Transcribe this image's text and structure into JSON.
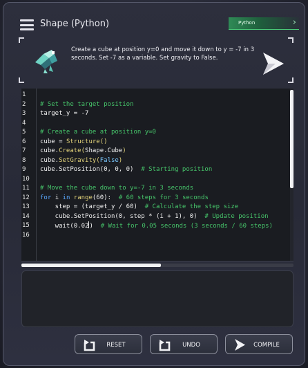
{
  "header": {
    "title": "Shape (Python)",
    "language_tab": "Python"
  },
  "task": {
    "text": "Create a cube at position y=0 and move it down to y = -7 in 3 seconds. Set -7 as a variable. Set gravity to False."
  },
  "editor": {
    "line_numbers": [
      "1",
      "2",
      "3",
      "4",
      "5",
      "6",
      "7",
      "8",
      "9",
      "10",
      "11",
      "12",
      "13",
      "14",
      "15",
      "16"
    ],
    "lines": [
      [],
      [
        {
          "t": "# Set the target position",
          "c": "comment"
        }
      ],
      [
        {
          "t": "target_y = -7",
          "c": "ident"
        }
      ],
      [],
      [
        {
          "t": "# Create a cube at position y=0",
          "c": "comment"
        }
      ],
      [
        {
          "t": "cube = ",
          "c": "ident"
        },
        {
          "t": "Structure()",
          "c": "call"
        }
      ],
      [
        {
          "t": "cube.",
          "c": "ident"
        },
        {
          "t": "Create(",
          "c": "call"
        },
        {
          "t": "Shape.Cube",
          "c": "ident"
        },
        {
          "t": ")",
          "c": "call"
        }
      ],
      [
        {
          "t": "cube.",
          "c": "ident"
        },
        {
          "t": "SetGravity(",
          "c": "call"
        },
        {
          "t": "False",
          "c": "const"
        },
        {
          "t": ")",
          "c": "call"
        }
      ],
      [
        {
          "t": "cube.SetPosition(0, 0, 0)  ",
          "c": "ident"
        },
        {
          "t": "# Starting position",
          "c": "comment"
        }
      ],
      [],
      [
        {
          "t": "# Move the cube down to y=-7 in 3 seconds",
          "c": "comment"
        }
      ],
      [
        {
          "t": "for ",
          "c": "keyword"
        },
        {
          "t": "i ",
          "c": "ident"
        },
        {
          "t": "in ",
          "c": "keyword"
        },
        {
          "t": "range",
          "c": "call"
        },
        {
          "t": "(60):  ",
          "c": "ident"
        },
        {
          "t": "# 60 steps for 3 seconds",
          "c": "comment"
        }
      ],
      [
        {
          "t": "    step = (target_y / 60)  ",
          "c": "ident"
        },
        {
          "t": "# Calculate the step size",
          "c": "comment"
        }
      ],
      [
        {
          "t": "    cube.SetPosition(0, step * (i + 1), 0)  ",
          "c": "ident"
        },
        {
          "t": "# Update position",
          "c": "comment"
        }
      ],
      [
        {
          "t": "    wait(0.02",
          "c": "ident"
        },
        {
          "t": "|caret|",
          "c": "caret"
        },
        {
          "t": ")  ",
          "c": "ident"
        },
        {
          "t": "# Wait for 0.05 seconds (3 seconds / 60 steps)",
          "c": "comment"
        }
      ],
      []
    ]
  },
  "buttons": {
    "reset": "RESET",
    "undo": "UNDO",
    "compile": "COMPILE"
  },
  "colors": {
    "comment": "#46c46a",
    "keyword": "#5aa8ff",
    "call": "#e3d37a",
    "accent_green": "#2f8a56"
  },
  "icons": {
    "menu": "hamburger-menu-icon",
    "task": "robot-bird-icon",
    "run": "play-arrow-icon",
    "reset": "reset-arrow-icon",
    "undo": "undo-arrow-icon",
    "compile": "compile-arrow-icon"
  }
}
